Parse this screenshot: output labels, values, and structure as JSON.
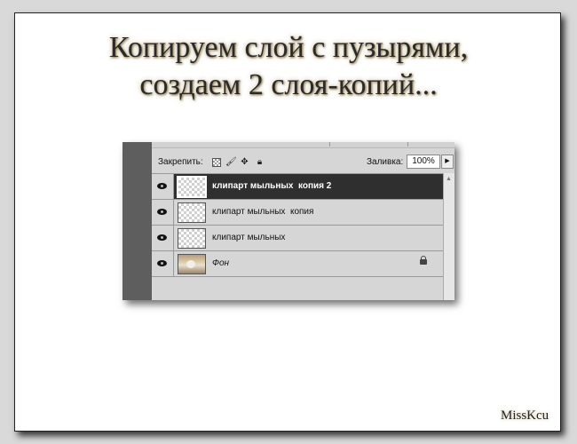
{
  "heading": {
    "line1": "Копируем слой с пузырями,",
    "line2": "создаем 2 слоя-копий..."
  },
  "layers_panel": {
    "lock_label": "Закрепить:",
    "lock_icons": [
      "transparency-lock-icon",
      "brush-icon",
      "move-icon",
      "padlock-icon"
    ],
    "fill_label": "Заливка:",
    "fill_value": "100%",
    "layers": [
      {
        "name": "клипарт мыльных  копия 2",
        "selected": true,
        "visible": true
      },
      {
        "name": "клипарт мыльных  копия",
        "selected": false,
        "visible": true
      },
      {
        "name": "клипарт мыльных",
        "selected": false,
        "visible": true
      },
      {
        "name": "Фон",
        "selected": false,
        "visible": true,
        "locked": true
      }
    ]
  },
  "signature": "MissKcu",
  "colors": {
    "selected_layer": "#2f2f2f",
    "panel_bg": "#d6d6d6",
    "gutter": "#5e5e5e"
  }
}
